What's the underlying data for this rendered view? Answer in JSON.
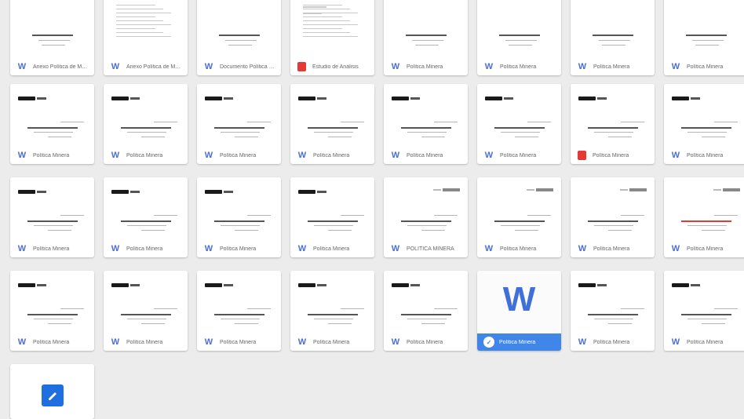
{
  "accent_color": "#3f86e8",
  "word_icon_color": "#4a6fd6",
  "pdf_icon_color": "#e53935",
  "rows": [
    [
      {
        "type": "word",
        "name": "Anexo Política de Minería"
      },
      {
        "type": "word",
        "name": "Anexo Política de Minería"
      },
      {
        "type": "word",
        "name": "Documento Política Minera"
      },
      {
        "type": "pdf",
        "name": "Estudio de Análisis"
      },
      {
        "type": "word",
        "name": "Política Minera"
      },
      {
        "type": "word",
        "name": "Política Minera"
      },
      {
        "type": "word",
        "name": "Política Minera"
      },
      {
        "type": "word",
        "name": "Política Minera"
      }
    ],
    [
      {
        "type": "word",
        "name": "Política Minera"
      },
      {
        "type": "word",
        "name": "Política Minera"
      },
      {
        "type": "word",
        "name": "Política Minera"
      },
      {
        "type": "word",
        "name": "Política Minera"
      },
      {
        "type": "word",
        "name": "Política Minera"
      },
      {
        "type": "word",
        "name": "Política Minera"
      },
      {
        "type": "pdf",
        "name": "Política Minera"
      },
      {
        "type": "word",
        "name": "Política Minera"
      }
    ],
    [
      {
        "type": "word",
        "name": "Política Minera"
      },
      {
        "type": "word",
        "name": "Política Minera"
      },
      {
        "type": "word",
        "name": "Política Minera"
      },
      {
        "type": "word",
        "name": "Política Minera"
      },
      {
        "type": "word",
        "name": "POLÍTICA MINERA"
      },
      {
        "type": "word",
        "name": "Política Minera"
      },
      {
        "type": "word",
        "name": "Política Minera"
      },
      {
        "type": "word",
        "name": "Política Minera"
      }
    ],
    [
      {
        "type": "word",
        "name": "Política Minera"
      },
      {
        "type": "word",
        "name": "Política Minera"
      },
      {
        "type": "word",
        "name": "Política Minera"
      },
      {
        "type": "word",
        "name": "Política Minera"
      },
      {
        "type": "word",
        "name": "Política Minera"
      },
      {
        "type": "word",
        "name": "Política Minera",
        "selected": true
      },
      {
        "type": "word",
        "name": "Política Minera"
      },
      {
        "type": "word",
        "name": "Política Minera"
      }
    ]
  ],
  "selected_big_icon": "W",
  "word_glyph": "W",
  "pdf_glyph": "PDF"
}
